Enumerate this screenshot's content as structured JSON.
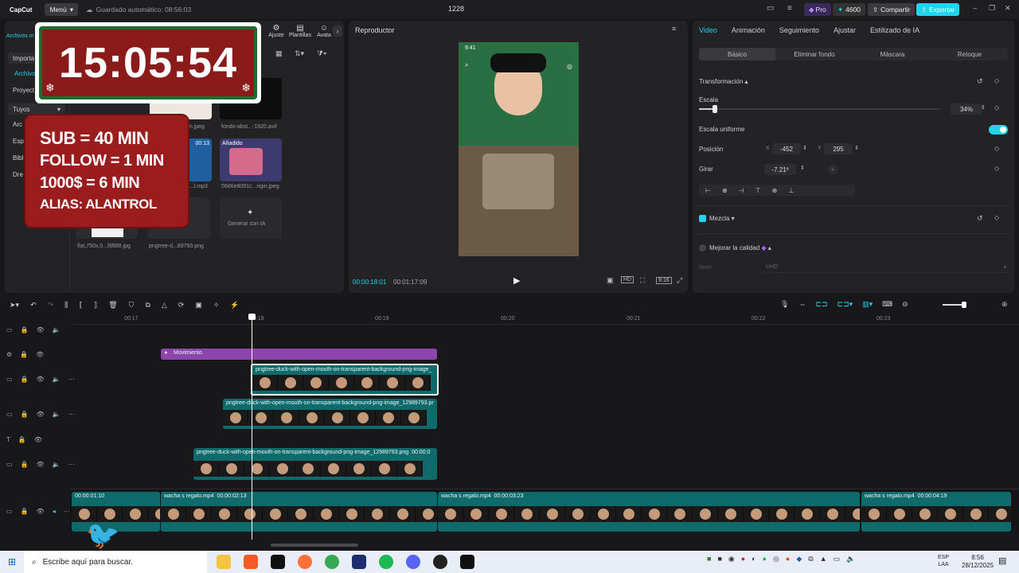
{
  "colors": {
    "accent": "#22d3ee",
    "pro": "#7c3aed",
    "export": "#22d3ee",
    "track_purple": "#8e44ad",
    "clip_teal": "#0f6b6b",
    "overlay_red": "#9b1c1c"
  },
  "titlebar": {
    "app_name": "CapCut",
    "menu_label": "Menú",
    "autosave": "Guardado automático: 08:56:03",
    "project_title": "1228",
    "pro_label": "Pro",
    "credits": "4600",
    "share_label": "Compartir",
    "export_label": "Exportar"
  },
  "media_panel": {
    "tabs": [
      "Ajuste",
      "Plantillas",
      "Avata"
    ],
    "sidebar": [
      "Importa",
      "Archivo",
      "Proyect",
      "Tuyos",
      "Arc",
      "Esp",
      "Bibl",
      "Dre"
    ],
    "sidebar_top": "Archivos m",
    "thumbs": [
      {
        "label": "...n.jpeg"
      },
      {
        "label": "fondo-abst...-1920.avif"
      },
      {
        "label": "...l.mp3",
        "badge": "00:13"
      },
      {
        "label": "5686e8091c...rigin.jpeg",
        "badge": "Añadido"
      },
      {
        "label": "flat,750x,0...f8f8f8.jpg"
      },
      {
        "label": "pngtree-d...89793.png"
      }
    ],
    "generate_label": "Generar con IA"
  },
  "overlay": {
    "clock": "15:05:54",
    "lines": [
      "SUB = 40 MIN",
      "FOLLOW = 1 MIN",
      "1000$ = 6 MIN",
      "ALIAS: ALANTROL"
    ]
  },
  "player": {
    "title": "Reproductor",
    "current_time": "00:00:18:01",
    "total_time": "00:01:17:09",
    "phone_time": "9:41",
    "ratio_label": "9:16"
  },
  "inspector": {
    "tabs": [
      "Video",
      "Animación",
      "Seguimiento",
      "Ajustar",
      "Estilizado de IA"
    ],
    "subtabs": [
      "Básico",
      "Eliminar fondo",
      "Máscara",
      "Retoque"
    ],
    "transform_label": "Transformación",
    "scale_label": "Escala",
    "scale_value": "34%",
    "scale_percent": 34,
    "uniform_label": "Escala uniforme",
    "position_label": "Posición",
    "x_label": "X",
    "x_value": "-452",
    "y_label": "Y",
    "y_value": "295",
    "rotate_label": "Girar",
    "rotate_value": "-7.21º",
    "blend_label": "Mezcla",
    "enhance_label": "Mejorar la calidad",
    "level_label": "Nivel",
    "level_value": "UHD"
  },
  "timeline": {
    "ticks": [
      "00:17",
      "00:18",
      "00:19",
      "00:20",
      "00:21",
      "00:22",
      "00:23"
    ],
    "movement_label": "Movimiento",
    "clip1": "pngtree-duck-with-open-mouth-on-transparent-background-png-image_",
    "clip2": "pngtree-duck-with-open-mouth-on-transparent-background-png-image_12989793.pr",
    "clip3": "pngtree-duck-with-open-mouth-on-transparent-background-png-image_12989793.png",
    "clip3_time": "00:00:0",
    "main_clips": [
      {
        "label": "00:00:01:10"
      },
      {
        "label": "wacha s regalo.mp4",
        "time": "00:00:02:13"
      },
      {
        "label": "wacha s regalo.mp4",
        "time": "00:00:03:23"
      },
      {
        "label": "wacha s regalo.mp4",
        "time": "00:00:04:19"
      }
    ]
  },
  "taskbar": {
    "search_placeholder": "Escribe aquí para buscar.",
    "lang": "ESP",
    "layout": "LAA",
    "time": "8:56",
    "date": "28/12/2025"
  }
}
